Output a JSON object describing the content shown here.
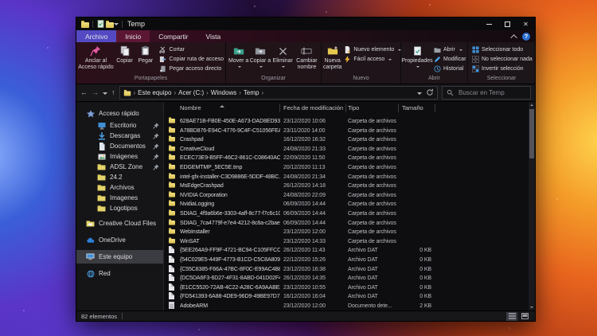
{
  "titlebar": {
    "title": "Temp"
  },
  "glyphs": {
    "crumb_sep": "›",
    "back": "←",
    "forward": "→",
    "up": "↑",
    "help": "?",
    "close": "✕"
  },
  "tabs": {
    "archivo": "Archivo",
    "inicio": "Inicio",
    "compartir": "Compartir",
    "vista": "Vista"
  },
  "ribbon": {
    "pin": "Anclar al Acceso rápido",
    "copy": "Copiar",
    "paste": "Pegar",
    "cut": "Cortar",
    "copy_path": "Copiar ruta de acceso",
    "paste_shortcut": "Pegar acceso directo",
    "group_clipboard": "Portapapeles",
    "move_to": "Mover a",
    "copy_to": "Copiar a",
    "delete": "Eliminar",
    "rename": "Cambiar nombre",
    "group_organize": "Organizar",
    "new_folder": "Nueva carpeta",
    "new_item": "Nuevo elemento",
    "easy_access": "Fácil acceso",
    "group_new": "Nuevo",
    "properties": "Propiedades",
    "open": "Abrir",
    "edit": "Modificar",
    "history": "Historial",
    "group_open": "Abrir",
    "select_all": "Seleccionar todo",
    "select_none": "No seleccionar nada",
    "invert_selection": "Invertir selección",
    "group_select": "Seleccionar"
  },
  "addressbar": {
    "breadcrumb": [
      "Este equipo",
      "Acer (C:)",
      "Windows",
      "Temp"
    ],
    "search_placeholder": "Buscar en Temp"
  },
  "columns": {
    "name": "Nombre",
    "date": "Fecha de modificación",
    "type": "Tipo",
    "size": "Tamaño"
  },
  "sidebar": {
    "items": [
      {
        "label": "Acceso rápido",
        "icon": "star",
        "level": 0,
        "pinned": false
      },
      {
        "label": "Escritorio",
        "icon": "desktop",
        "level": 1,
        "pinned": true
      },
      {
        "label": "Descargas",
        "icon": "downloads",
        "level": 1,
        "pinned": true
      },
      {
        "label": "Documentos",
        "icon": "documents",
        "level": 1,
        "pinned": true
      },
      {
        "label": "Imágenes",
        "icon": "pictures",
        "level": 1,
        "pinned": true
      },
      {
        "label": "ADSL Zone",
        "icon": "folder",
        "level": 1,
        "pinned": true
      },
      {
        "label": "24.2",
        "icon": "folder",
        "level": 1,
        "pinned": false
      },
      {
        "label": "Archivos",
        "icon": "folder",
        "level": 1,
        "pinned": false
      },
      {
        "label": "Imagenes",
        "icon": "folder",
        "level": 1,
        "pinned": false
      },
      {
        "label": "Logotipos",
        "icon": "folder",
        "level": 1,
        "pinned": false
      },
      {
        "label": "Creative Cloud Files",
        "icon": "ccfolder",
        "level": 0,
        "pinned": false,
        "gap": true
      },
      {
        "label": "OneDrive",
        "icon": "onedrive",
        "level": 0,
        "pinned": false,
        "gap": true
      },
      {
        "label": "Este equipo",
        "icon": "computer",
        "level": 0,
        "pinned": false,
        "gap": true,
        "selected": true
      },
      {
        "label": "Red",
        "icon": "network",
        "level": 0,
        "pinned": false,
        "gap": true
      }
    ]
  },
  "files": [
    {
      "name": "628AE71B-FB0E-450E-A673-DAD8ED93D5...",
      "date": "23/12/2020 10:06",
      "type": "Carpeta de archivos",
      "size": "",
      "icon": "folder"
    },
    {
      "name": "A78BD876-E94C-4776-9C4F-C51056FEAC72",
      "date": "23/11/2020 14:00",
      "type": "Carpeta de archivos",
      "size": "",
      "icon": "folder"
    },
    {
      "name": "Crashpad",
      "date": "16/12/2020 16:32",
      "type": "Carpeta de archivos",
      "size": "",
      "icon": "folder"
    },
    {
      "name": "CreativeCloud",
      "date": "24/08/2020 21:33",
      "type": "Carpeta de archivos",
      "size": "",
      "icon": "folder"
    },
    {
      "name": "ECEC73E9-B5FF-46C2-861C-C08640ACA...",
      "date": "22/09/2020 11:50",
      "type": "Carpeta de archivos",
      "size": "",
      "icon": "folder"
    },
    {
      "name": "EDGEMTMP_5EC5E.tmp",
      "date": "20/12/2020 11:13",
      "type": "Carpeta de archivos",
      "size": "",
      "icon": "folder"
    },
    {
      "name": "intel-gfx-installer-C3D9886E-5DDF-48BC...",
      "date": "24/08/2020 21:34",
      "type": "Carpeta de archivos",
      "size": "",
      "icon": "folder"
    },
    {
      "name": "MsEdgeCrashpad",
      "date": "26/12/2020 14:18",
      "type": "Carpeta de archivos",
      "size": "",
      "icon": "folder"
    },
    {
      "name": "NVIDIA Corporation",
      "date": "24/08/2020 22:09",
      "type": "Carpeta de archivos",
      "size": "",
      "icon": "folder"
    },
    {
      "name": "NvidiaLogging",
      "date": "06/09/2020 14:44",
      "type": "Carpeta de archivos",
      "size": "",
      "icon": "folder"
    },
    {
      "name": "SDIAG_4f9a6b6e-3303-4aff-8c77-f7c6c10...",
      "date": "06/09/2020 14:44",
      "type": "Carpeta de archivos",
      "size": "",
      "icon": "folder"
    },
    {
      "name": "SDIAG_7ca4779f-e7e4-4212-8c8a-c2baed...",
      "date": "06/09/2020 14:44",
      "type": "Carpeta de archivos",
      "size": "",
      "icon": "folder"
    },
    {
      "name": "WebInstaller",
      "date": "23/12/2020 12:00",
      "type": "Carpeta de archivos",
      "size": "",
      "icon": "folder"
    },
    {
      "name": "WinSAT",
      "date": "23/12/2020 14:33",
      "type": "Carpeta de archivos",
      "size": "",
      "icon": "folder"
    },
    {
      "name": "{5EE264A9-FF9F-4721-BC94-C105FFCC58...",
      "date": "26/12/2020 11:43",
      "type": "Archivo DAT",
      "size": "0 KB",
      "icon": "dat"
    },
    {
      "name": "{54C029E5-449F-4773-B1CD-C5C8A809F...",
      "date": "22/12/2020 15:26",
      "type": "Archivo DAT",
      "size": "0 KB",
      "icon": "dat"
    },
    {
      "name": "{C55C8385-F66A-47BC-8F0C-E99AC4B89...",
      "date": "23/12/2020 16:38",
      "type": "Archivo DAT",
      "size": "0 KB",
      "icon": "dat"
    },
    {
      "name": "{DC5DA6F3-6D27-4F31-8ABD-041D02F4F...",
      "date": "26/12/2020 14:35",
      "type": "Archivo DAT",
      "size": "0 KB",
      "icon": "dat"
    },
    {
      "name": "{E1CC5520-72AB-4C22-A28C-6A9AABE2...",
      "date": "23/12/2020 10:55",
      "type": "Archivo DAT",
      "size": "0 KB",
      "icon": "dat"
    },
    {
      "name": "{FD541393-6A88-4DE9-96D9-49BE97D729...",
      "date": "16/12/2020 16:04",
      "type": "Archivo DAT",
      "size": "0 KB",
      "icon": "dat"
    },
    {
      "name": "AdobeARM",
      "date": "23/12/2020 12:00",
      "type": "Documento dete...",
      "size": "2 KB",
      "icon": "doc"
    }
  ],
  "statusbar": {
    "count": "82 elementos"
  }
}
